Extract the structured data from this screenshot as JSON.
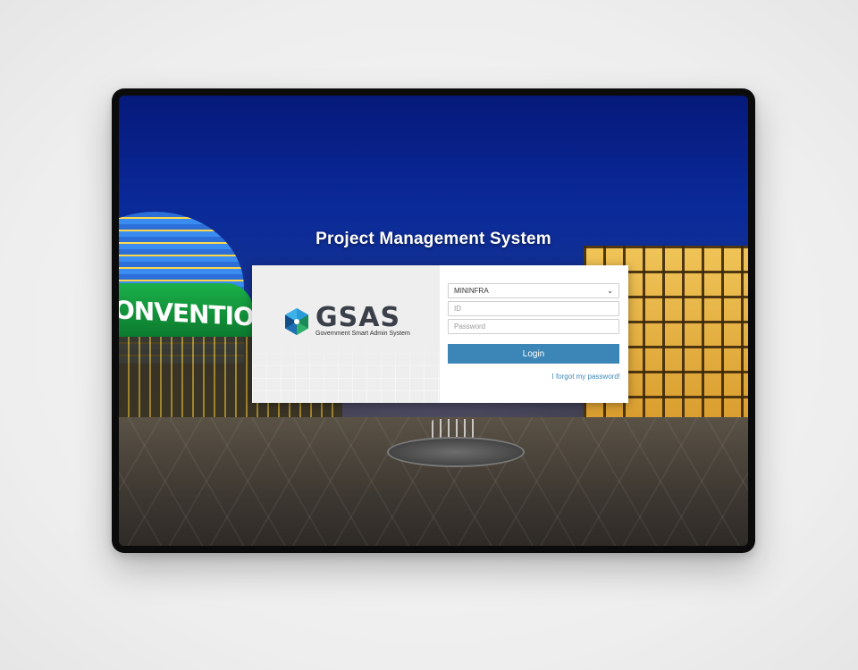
{
  "page": {
    "title": "Project Management System"
  },
  "background": {
    "sign_text": "ONVENTION"
  },
  "brand": {
    "logo_word": "GSAS",
    "logo_subtitle": "Government Smart Admin System"
  },
  "login_form": {
    "organization_selected": "MININFRA",
    "id_placeholder": "ID",
    "password_placeholder": "Password",
    "login_label": "Login",
    "forgot_label": "I forgot my password!"
  },
  "colors": {
    "accent": "#3b86b6",
    "sky": "#0a2a9a"
  },
  "icons": {
    "logo_mark": "gsas-hexagon-logo",
    "select_chevron": "chevron-down"
  }
}
